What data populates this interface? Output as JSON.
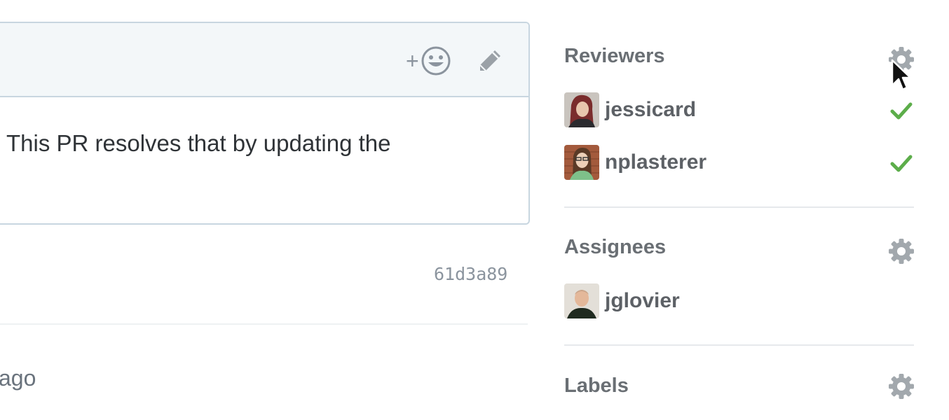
{
  "comment": {
    "body_text": "This PR resolves that by updating the",
    "reaction_plus": "+"
  },
  "timeline": {
    "commit_sha": "61d3a89",
    "time_fragment": "ago"
  },
  "sidebar": {
    "reviewers": {
      "title": "Reviewers",
      "people": [
        {
          "name": "jessicard",
          "status": "approved"
        },
        {
          "name": "nplasterer",
          "status": "approved"
        }
      ]
    },
    "assignees": {
      "title": "Assignees",
      "people": [
        {
          "name": "jglovier"
        }
      ]
    },
    "labels": {
      "title": "Labels"
    }
  },
  "colors": {
    "check_green": "#5cad4a",
    "icon_gray": "#9aa1a7",
    "border": "#c8d6e0"
  }
}
